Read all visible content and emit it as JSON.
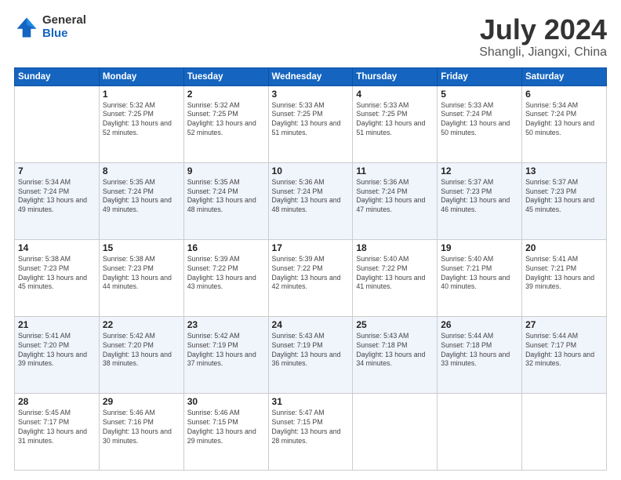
{
  "logo": {
    "general": "General",
    "blue": "Blue"
  },
  "title": "July 2024",
  "subtitle": "Shangli, Jiangxi, China",
  "weekdays": [
    "Sunday",
    "Monday",
    "Tuesday",
    "Wednesday",
    "Thursday",
    "Friday",
    "Saturday"
  ],
  "weeks": [
    [
      {
        "day": "",
        "info": ""
      },
      {
        "day": "1",
        "info": "Sunrise: 5:32 AM\nSunset: 7:25 PM\nDaylight: 13 hours\nand 52 minutes."
      },
      {
        "day": "2",
        "info": "Sunrise: 5:32 AM\nSunset: 7:25 PM\nDaylight: 13 hours\nand 52 minutes."
      },
      {
        "day": "3",
        "info": "Sunrise: 5:33 AM\nSunset: 7:25 PM\nDaylight: 13 hours\nand 51 minutes."
      },
      {
        "day": "4",
        "info": "Sunrise: 5:33 AM\nSunset: 7:25 PM\nDaylight: 13 hours\nand 51 minutes."
      },
      {
        "day": "5",
        "info": "Sunrise: 5:33 AM\nSunset: 7:24 PM\nDaylight: 13 hours\nand 50 minutes."
      },
      {
        "day": "6",
        "info": "Sunrise: 5:34 AM\nSunset: 7:24 PM\nDaylight: 13 hours\nand 50 minutes."
      }
    ],
    [
      {
        "day": "7",
        "info": "Sunrise: 5:34 AM\nSunset: 7:24 PM\nDaylight: 13 hours\nand 49 minutes."
      },
      {
        "day": "8",
        "info": "Sunrise: 5:35 AM\nSunset: 7:24 PM\nDaylight: 13 hours\nand 49 minutes."
      },
      {
        "day": "9",
        "info": "Sunrise: 5:35 AM\nSunset: 7:24 PM\nDaylight: 13 hours\nand 48 minutes."
      },
      {
        "day": "10",
        "info": "Sunrise: 5:36 AM\nSunset: 7:24 PM\nDaylight: 13 hours\nand 48 minutes."
      },
      {
        "day": "11",
        "info": "Sunrise: 5:36 AM\nSunset: 7:24 PM\nDaylight: 13 hours\nand 47 minutes."
      },
      {
        "day": "12",
        "info": "Sunrise: 5:37 AM\nSunset: 7:23 PM\nDaylight: 13 hours\nand 46 minutes."
      },
      {
        "day": "13",
        "info": "Sunrise: 5:37 AM\nSunset: 7:23 PM\nDaylight: 13 hours\nand 45 minutes."
      }
    ],
    [
      {
        "day": "14",
        "info": "Sunrise: 5:38 AM\nSunset: 7:23 PM\nDaylight: 13 hours\nand 45 minutes."
      },
      {
        "day": "15",
        "info": "Sunrise: 5:38 AM\nSunset: 7:23 PM\nDaylight: 13 hours\nand 44 minutes."
      },
      {
        "day": "16",
        "info": "Sunrise: 5:39 AM\nSunset: 7:22 PM\nDaylight: 13 hours\nand 43 minutes."
      },
      {
        "day": "17",
        "info": "Sunrise: 5:39 AM\nSunset: 7:22 PM\nDaylight: 13 hours\nand 42 minutes."
      },
      {
        "day": "18",
        "info": "Sunrise: 5:40 AM\nSunset: 7:22 PM\nDaylight: 13 hours\nand 41 minutes."
      },
      {
        "day": "19",
        "info": "Sunrise: 5:40 AM\nSunset: 7:21 PM\nDaylight: 13 hours\nand 40 minutes."
      },
      {
        "day": "20",
        "info": "Sunrise: 5:41 AM\nSunset: 7:21 PM\nDaylight: 13 hours\nand 39 minutes."
      }
    ],
    [
      {
        "day": "21",
        "info": "Sunrise: 5:41 AM\nSunset: 7:20 PM\nDaylight: 13 hours\nand 39 minutes."
      },
      {
        "day": "22",
        "info": "Sunrise: 5:42 AM\nSunset: 7:20 PM\nDaylight: 13 hours\nand 38 minutes."
      },
      {
        "day": "23",
        "info": "Sunrise: 5:42 AM\nSunset: 7:19 PM\nDaylight: 13 hours\nand 37 minutes."
      },
      {
        "day": "24",
        "info": "Sunrise: 5:43 AM\nSunset: 7:19 PM\nDaylight: 13 hours\nand 36 minutes."
      },
      {
        "day": "25",
        "info": "Sunrise: 5:43 AM\nSunset: 7:18 PM\nDaylight: 13 hours\nand 34 minutes."
      },
      {
        "day": "26",
        "info": "Sunrise: 5:44 AM\nSunset: 7:18 PM\nDaylight: 13 hours\nand 33 minutes."
      },
      {
        "day": "27",
        "info": "Sunrise: 5:44 AM\nSunset: 7:17 PM\nDaylight: 13 hours\nand 32 minutes."
      }
    ],
    [
      {
        "day": "28",
        "info": "Sunrise: 5:45 AM\nSunset: 7:17 PM\nDaylight: 13 hours\nand 31 minutes."
      },
      {
        "day": "29",
        "info": "Sunrise: 5:46 AM\nSunset: 7:16 PM\nDaylight: 13 hours\nand 30 minutes."
      },
      {
        "day": "30",
        "info": "Sunrise: 5:46 AM\nSunset: 7:15 PM\nDaylight: 13 hours\nand 29 minutes."
      },
      {
        "day": "31",
        "info": "Sunrise: 5:47 AM\nSunset: 7:15 PM\nDaylight: 13 hours\nand 28 minutes."
      },
      {
        "day": "",
        "info": ""
      },
      {
        "day": "",
        "info": ""
      },
      {
        "day": "",
        "info": ""
      }
    ]
  ]
}
